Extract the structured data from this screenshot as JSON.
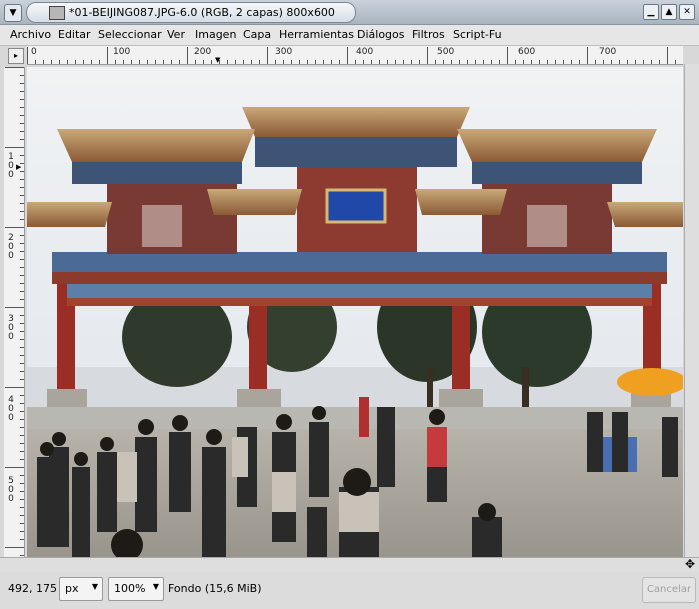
{
  "window": {
    "title": "*01-BEIJING087.JPG-6.0 (RGB, 2 capas) 800x600"
  },
  "menu": [
    {
      "label": "Archivo"
    },
    {
      "label": "Editar"
    },
    {
      "label": "Seleccionar"
    },
    {
      "label": "Ver"
    },
    {
      "label": "Imagen"
    },
    {
      "label": "Capa"
    },
    {
      "label": "Herramientas"
    },
    {
      "label": "Diálogos"
    },
    {
      "label": "Filtros"
    },
    {
      "label": "Script-Fu"
    }
  ],
  "rulers": {
    "horizontal": [
      "0",
      "100",
      "200",
      "300",
      "400",
      "500",
      "600",
      "700"
    ],
    "vertical": [
      "100",
      "200",
      "300",
      "400",
      "500"
    ]
  },
  "status": {
    "coords": "492, 175",
    "unit": "px",
    "zoom": "100%",
    "layer_info": "Fondo (15,6 MiB)",
    "cancel": "Cancelar"
  },
  "icons": {
    "window_menu": "chevron-down-icon",
    "image_type": "image-file-icon",
    "minimize": "minimize-icon",
    "maximize": "maximize-icon",
    "close": "close-icon",
    "navigate": "move-arrows-icon"
  }
}
